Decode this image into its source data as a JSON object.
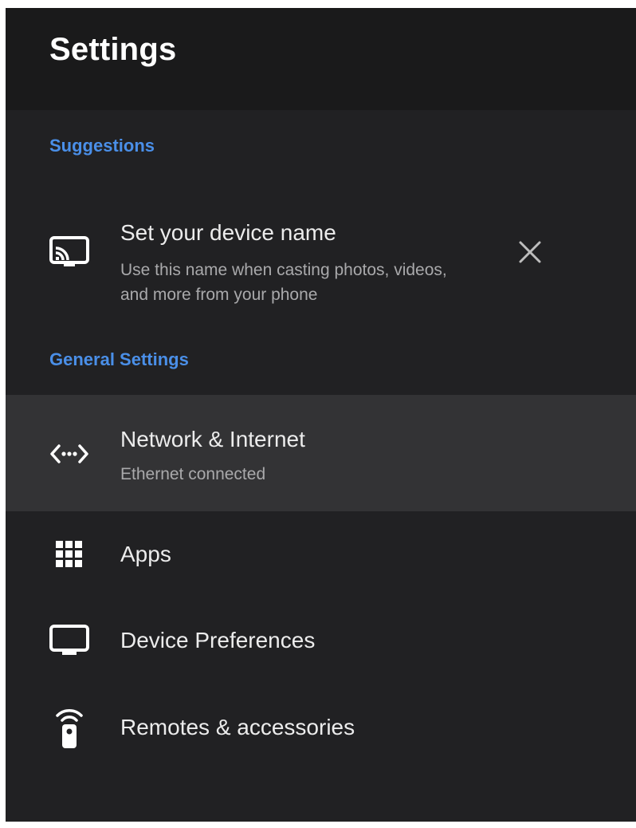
{
  "header": {
    "title": "Settings"
  },
  "suggestions": {
    "label": "Suggestions",
    "item": {
      "title": "Set your device name",
      "subtitle_line1": "Use this name when casting photos, videos,",
      "subtitle_line2": "and more from your phone",
      "icon": "cast-icon",
      "dismiss_icon": "close-icon"
    }
  },
  "general": {
    "label": "General Settings",
    "items": [
      {
        "title": "Network & Internet",
        "subtitle": "Ethernet connected",
        "icon": "network-icon",
        "selected": true
      },
      {
        "title": "Apps",
        "icon": "apps-grid-icon"
      },
      {
        "title": "Device Preferences",
        "icon": "tv-icon"
      },
      {
        "title": "Remotes & accessories",
        "icon": "remote-icon"
      }
    ]
  },
  "colors": {
    "background": "#212123",
    "header_background": "#1a1a1b",
    "selected_row": "#333335",
    "accent": "#4a8fe8",
    "primary_text": "#ececec",
    "secondary_text": "#a9a9ab"
  }
}
